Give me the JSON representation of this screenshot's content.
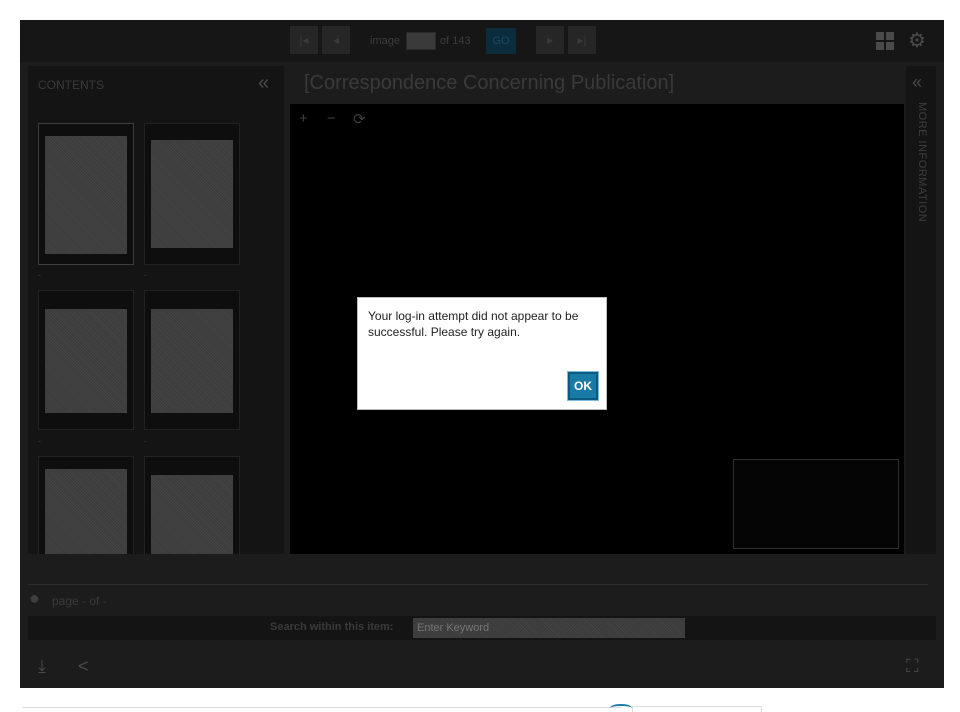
{
  "toolbar": {
    "first_icon": "skip-first-icon",
    "prev_icon": "prev-icon",
    "image_label": "image",
    "image_value": "",
    "of_label": "of 143",
    "go_label": "GO",
    "next_icon": "next-icon",
    "last_icon": "skip-last-icon",
    "grid_icon": "grid-view-icon",
    "settings_icon": "gear-icon"
  },
  "sidebar": {
    "title": "CONTENTS",
    "collapse_icon": "«",
    "thumbnails": [
      {
        "caption": "-"
      },
      {
        "caption": "-"
      },
      {
        "caption": "-"
      },
      {
        "caption": "-"
      },
      {
        "caption": ""
      },
      {
        "caption": ""
      }
    ]
  },
  "document": {
    "title": "[Correspondence Concerning Publication]",
    "zoom_in": "+",
    "zoom_out": "−",
    "rotate": "⟳"
  },
  "info_panel": {
    "collapse_icon": "«",
    "label": "MORE INFORMATION"
  },
  "footer": {
    "page_info": "page - of -",
    "search_label": "Search within this item:",
    "search_placeholder": "Enter Keyword",
    "download_icon": "download-icon",
    "share_icon": "share-icon",
    "fullscreen_icon": "fullscreen-icon"
  },
  "dialog": {
    "message": "Your log-in attempt did not appear to be successful. Please try again.",
    "ok_label": "OK"
  },
  "colors": {
    "accent": "#1a7aa6",
    "overlay_bg": "#000000"
  }
}
